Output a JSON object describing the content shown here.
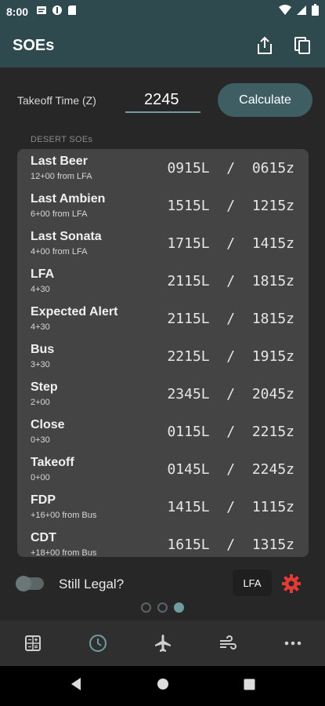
{
  "status_bar": {
    "time": "8:00"
  },
  "app_bar": {
    "title": "SOEs"
  },
  "takeoff": {
    "label": "Takeoff Time (Z)",
    "value": "2245",
    "button_label": "Calculate"
  },
  "section": {
    "label": "DESERT SOEs"
  },
  "soes": [
    {
      "name": "Last Beer",
      "sub": "12+00 from LFA",
      "local": "0915L",
      "zulu": "0615z"
    },
    {
      "name": "Last Ambien",
      "sub": "6+00 from LFA",
      "local": "1515L",
      "zulu": "1215z"
    },
    {
      "name": "Last Sonata",
      "sub": "4+00 from LFA",
      "local": "1715L",
      "zulu": "1415z"
    },
    {
      "name": "LFA",
      "sub": "4+30",
      "local": "2115L",
      "zulu": "1815z"
    },
    {
      "name": "Expected Alert",
      "sub": "4+30",
      "local": "2115L",
      "zulu": "1815z"
    },
    {
      "name": "Bus",
      "sub": "3+30",
      "local": "2215L",
      "zulu": "1915z"
    },
    {
      "name": "Step",
      "sub": "2+00",
      "local": "2345L",
      "zulu": "2045z"
    },
    {
      "name": "Close",
      "sub": "0+30",
      "local": "0115L",
      "zulu": "2215z"
    },
    {
      "name": "Takeoff",
      "sub": "0+00",
      "local": "0145L",
      "zulu": "2245z"
    },
    {
      "name": "FDP",
      "sub": "+16+00 from Bus",
      "local": "1415L",
      "zulu": "1115z"
    },
    {
      "name": "CDT",
      "sub": "+18+00 from Bus",
      "local": "1615L",
      "zulu": "1315z"
    }
  ],
  "legal": {
    "label": "Still Legal?",
    "toggle_on": false,
    "chip_label": "LFA"
  },
  "pager": {
    "pages": 3,
    "active": 3
  },
  "bottom_nav": [
    "calculator-icon",
    "clock-icon",
    "airplane-icon",
    "wind-icon",
    "more-icon"
  ],
  "colors": {
    "app_bar": "#2e4a4f",
    "accent": "#6f9ca0",
    "button": "#3f5e63",
    "gear": "#e53935",
    "card": "#444444"
  }
}
